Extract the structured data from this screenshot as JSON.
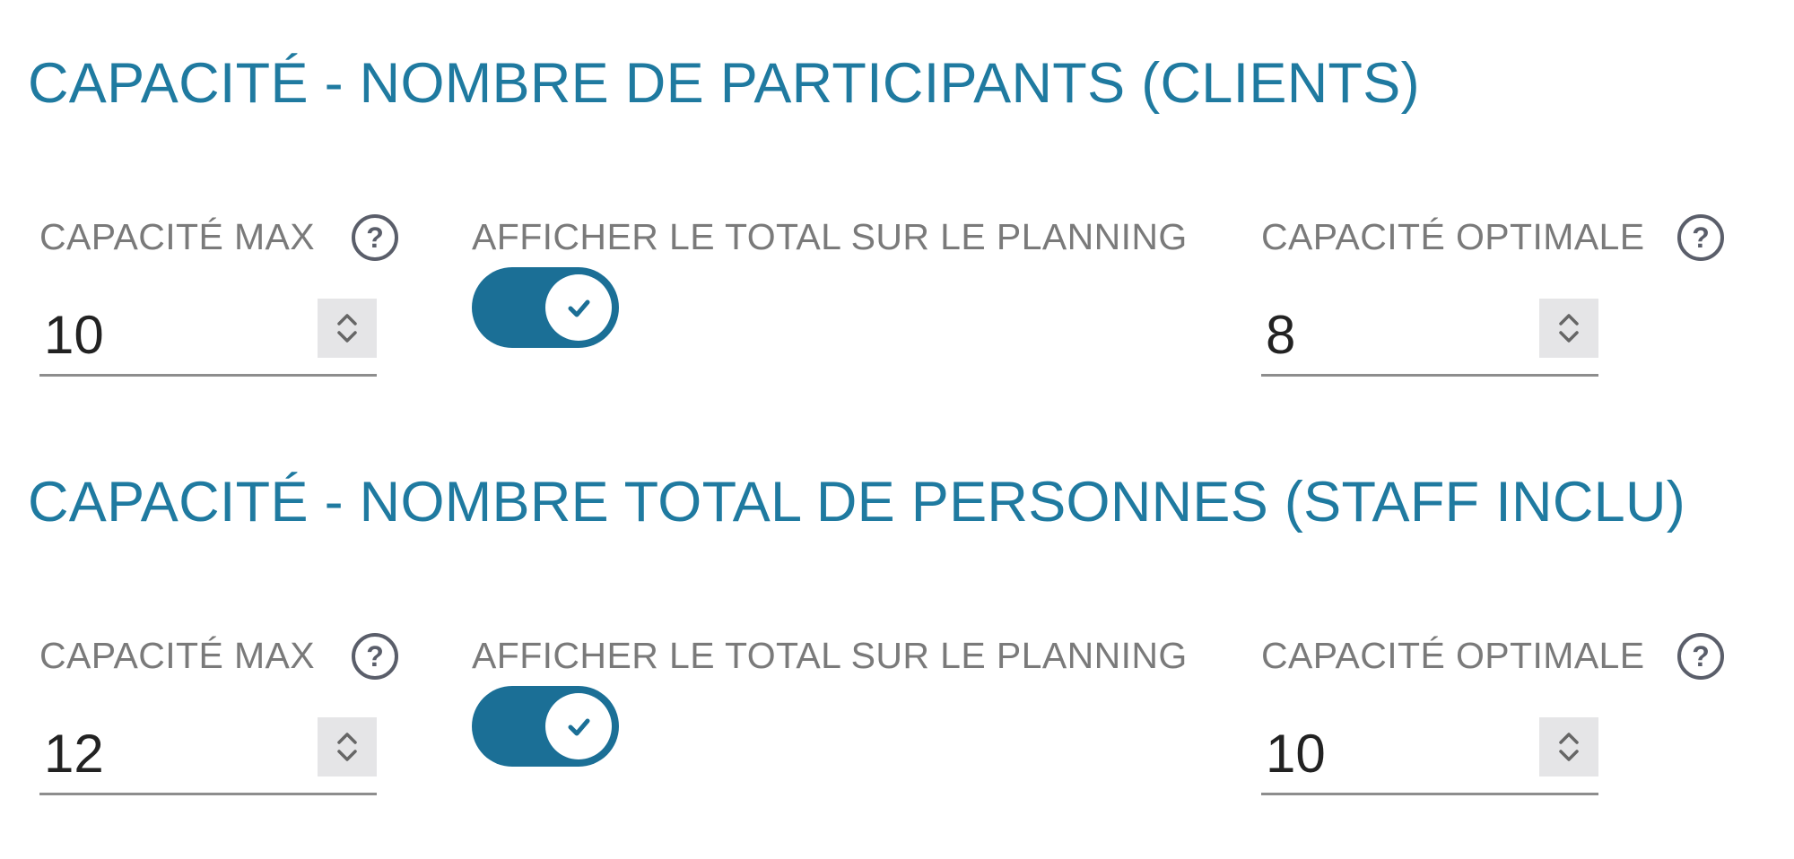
{
  "sections": [
    {
      "title": "CAPACITÉ - NOMBRE DE PARTICIPANTS (CLIENTS)",
      "max_capacity": {
        "label": "CAPACITÉ MAX",
        "value": "10",
        "help_icon": "question-circle-icon"
      },
      "show_total": {
        "label": "AFFICHER LE TOTAL SUR LE PLANNING",
        "checked": true
      },
      "optimal_capacity": {
        "label": "CAPACITÉ OPTIMALE",
        "value": "8",
        "help_icon": "question-circle-icon"
      }
    },
    {
      "title": "CAPACITÉ - NOMBRE TOTAL DE PERSONNES (STAFF INCLU)",
      "max_capacity": {
        "label": "CAPACITÉ MAX",
        "value": "12",
        "help_icon": "question-circle-icon"
      },
      "show_total": {
        "label": "AFFICHER LE TOTAL SUR LE PLANNING",
        "checked": true
      },
      "optimal_capacity": {
        "label": "CAPACITÉ OPTIMALE",
        "value": "10",
        "help_icon": "question-circle-icon"
      }
    }
  ],
  "colors": {
    "title": "#1f7aa0",
    "label": "#7a7a7a",
    "toggle_on": "#1b6f96",
    "help_icon": "#5a5e6a",
    "input_underline": "#8d8d8d",
    "spinner_background": "#e5e5e7"
  }
}
